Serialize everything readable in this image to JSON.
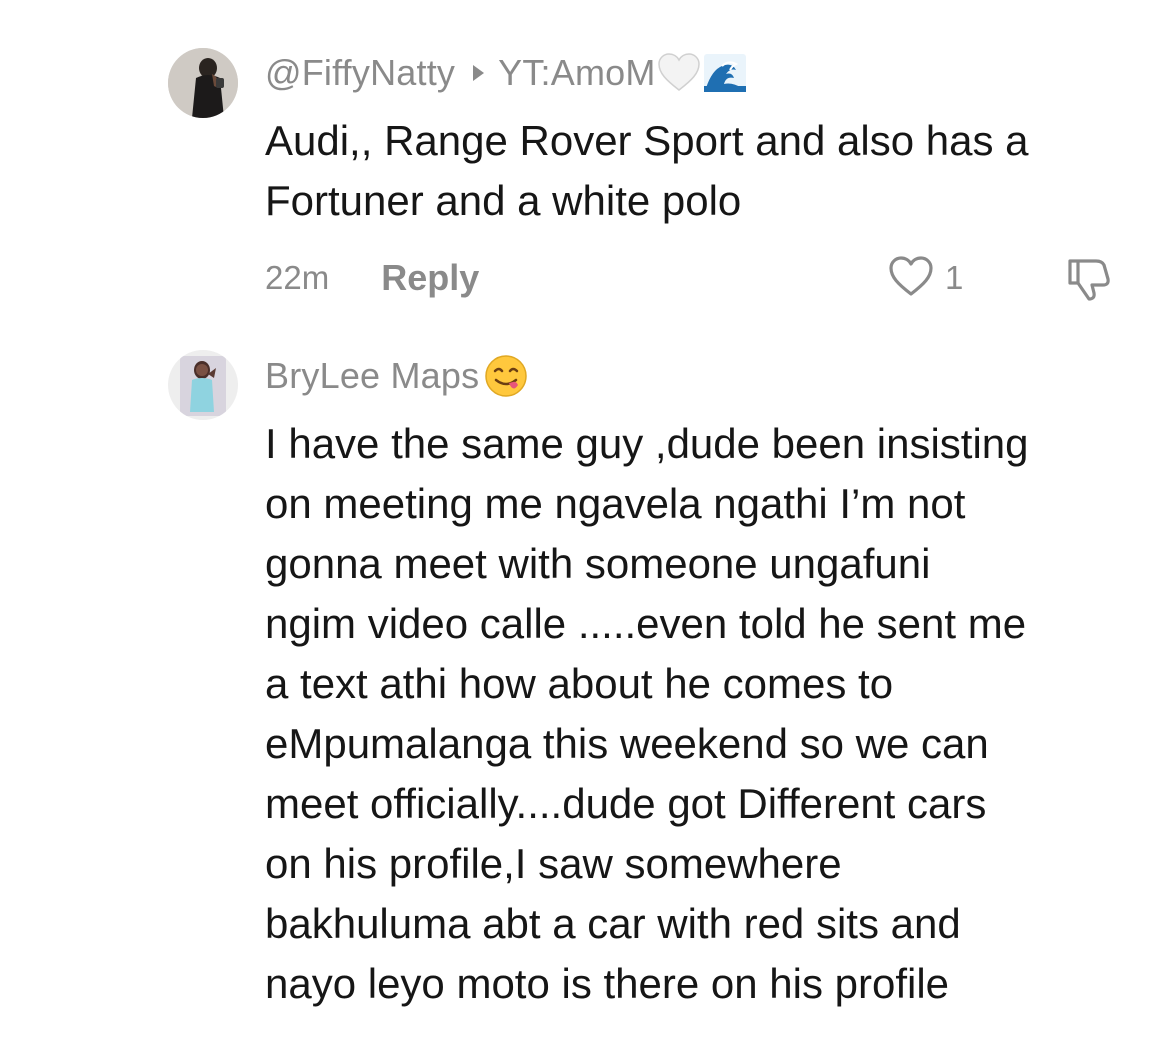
{
  "comments": [
    {
      "author": "@FiffyNatty",
      "reply_to": "YT:AmoM",
      "emojis": [
        "white-heart-emoji",
        "water-wave-emoji"
      ],
      "text": "Audi,, Range Rover Sport and also has a\nFortuner and a white polo",
      "time": "22m",
      "reply_label": "Reply",
      "like_count": "1"
    },
    {
      "author": "BryLee Maps",
      "emojis": [
        "face-savoring-food-emoji"
      ],
      "text": "I have the same guy ,dude been insisting\non meeting me ngavela ngathi I’m not\ngonna meet with someone ungafuni\nngim video calle .....even told he sent me\na text athi how about he comes to\neMpumalanga this weekend so we can\nmeet officially....dude got Different cars\non his profile,I saw somewhere\nbakhuluma abt a car with red sits and\nnayo leyo moto is there on his profile"
    }
  ],
  "colors": {
    "meta_gray": "#8a8a8a",
    "text": "#161616",
    "background": "#ffffff"
  }
}
